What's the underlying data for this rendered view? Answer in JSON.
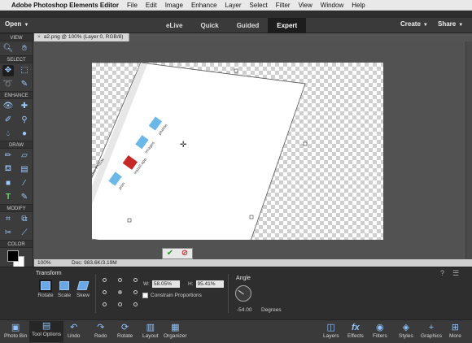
{
  "menubar": {
    "app_name": "Adobe Photoshop Elements Editor",
    "items": [
      "File",
      "Edit",
      "Image",
      "Enhance",
      "Layer",
      "Select",
      "Filter",
      "View",
      "Window",
      "Help"
    ]
  },
  "modebar": {
    "open_label": "Open",
    "tabs": [
      "eLive",
      "Quick",
      "Guided",
      "Expert"
    ],
    "active_tab": "Expert",
    "create_label": "Create",
    "share_label": "Share"
  },
  "toolbox": {
    "sections": [
      "VIEW",
      "SELECT",
      "ENHANCE",
      "DRAW",
      "MODIFY",
      "COLOR"
    ]
  },
  "document": {
    "tab_title": "a2.png @ 100% (Layer 0, RGB/8)",
    "close_glyph": "×"
  },
  "status": {
    "zoom": "100%",
    "doc_size": "Doc: 983.6K/3.19M"
  },
  "options": {
    "title": "Transform",
    "buttons": [
      "Rotate",
      "Scale",
      "Skew"
    ],
    "width_label": "W:",
    "width_value": "58.05%",
    "height_label": "H:",
    "height_value": "95.41%",
    "constrain_label": "Constrain Proportions",
    "angle_label": "Angle",
    "angle_value": "-54.00",
    "degrees_label": "Degrees"
  },
  "bottombar": {
    "left": [
      "Photo Bin",
      "Tool Options",
      "Undo",
      "Redo",
      "Rotate",
      "Layout",
      "Organizer"
    ],
    "right": [
      "Layers",
      "Effects",
      "Filters",
      "Styles",
      "Graphics",
      "More"
    ],
    "active": "Tool Options"
  },
  "image_content": {
    "window_title": "Drive Photos",
    "file_labels": [
      "plan",
      "install.app",
      "images",
      "photos"
    ]
  },
  "colors": {
    "accent_blue": "#6aa7e6",
    "active_tab": "#1d1d1d",
    "commit_green": "#2f9a2f",
    "cancel_red": "#c62828"
  }
}
